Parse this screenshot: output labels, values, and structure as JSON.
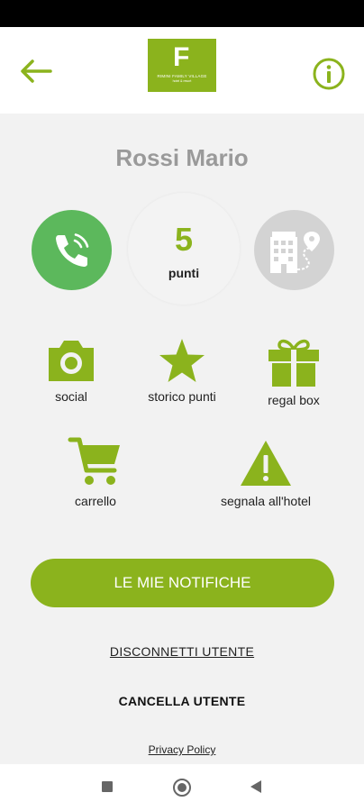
{
  "header": {
    "logo_letter": "F",
    "logo_line1": "RIMINI FAMILY VILLAGE",
    "logo_line2": "hotel & resort",
    "colors": {
      "accent": "#8bb31d",
      "call": "#5cb85c",
      "hotel": "#d3d3d3"
    }
  },
  "user": {
    "name": "Rossi Mario"
  },
  "points": {
    "value": "5",
    "label": "punti"
  },
  "menu": {
    "social": "social",
    "history": "storico punti",
    "gift": "regal box",
    "cart": "carrello",
    "report": "segnala all'hotel"
  },
  "actions": {
    "notifications": "LE MIE NOTIFICHE",
    "logout": "DISCONNETTI UTENTE",
    "delete": "CANCELLA UTENTE",
    "privacy": "Privacy Policy"
  },
  "icons": [
    "back-arrow-icon",
    "info-icon",
    "phone-icon",
    "hotel-map-icon",
    "camera-icon",
    "star-icon",
    "gift-icon",
    "cart-icon",
    "warning-icon"
  ]
}
